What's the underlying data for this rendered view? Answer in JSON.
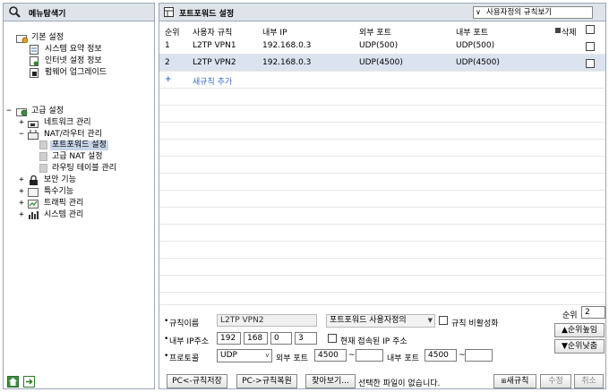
{
  "nav": {
    "title": "메뉴탐색기",
    "basic": {
      "label": "기본 설정",
      "items": [
        "시스템 요약 정보",
        "인터넷 설정 정보",
        "펌웨어 업그레이드"
      ]
    },
    "advanced": {
      "label": "고급 설정",
      "network": "네트워크 관리",
      "nat": "NAT/라우터 관리",
      "nat_items": [
        "포트포워드 설정",
        "고급 NAT 설정",
        "라우팅 테이블 관리"
      ],
      "others": [
        "보안 기능",
        "특수기능",
        "트래픽 관리",
        "시스템 관리"
      ]
    }
  },
  "main": {
    "title": "포트포워드 설정",
    "view_select": "사용자정의 규칙보기"
  },
  "table": {
    "headers": {
      "order": "순위",
      "rule": "사용자 규칙",
      "internal_ip": "내부 IP",
      "external_port": "외부 포트",
      "internal_port": "내부 포트",
      "delete": "삭제"
    },
    "rows": [
      {
        "order": "1",
        "rule": "L2TP VPN1",
        "ip": "192.168.0.3",
        "ext": "UDP(500)",
        "int": "UDP(500)"
      },
      {
        "order": "2",
        "rule": "L2TP VPN2",
        "ip": "192.168.0.3",
        "ext": "UDP(4500)",
        "int": "UDP(4500)"
      }
    ],
    "add_rule": "새규칙 추가",
    "add_plus": "+"
  },
  "form": {
    "rule_name_label": "규칙이름",
    "rule_name": "L2TP VPN2",
    "rule_type": "포트포워드 사용자정의",
    "disable_label": "규칙 비활성화",
    "ip_label": "내부 IP주소",
    "ip": [
      "192",
      "168",
      "0",
      "3"
    ],
    "current_ip_label": "현재 접속된 IP 주소",
    "protocol_label": "프로토콜",
    "protocol": "UDP",
    "ext_port_label": "외부 포트",
    "ext_port_from": "4500",
    "ext_port_to": "",
    "int_port_label": "내부 포트",
    "int_port_from": "4500",
    "int_port_to": "",
    "tilde": "~",
    "bullet": "•",
    "order_label": "순위",
    "order_value": "2",
    "order_up": "순위높임",
    "order_down": "순위낮춤"
  },
  "bottom": {
    "save_to_pc": "PC<-규칙저장",
    "restore_from_pc": "PC->규칙복원",
    "browse": "찾아보기...",
    "file_status": "선택한 파일이 없습니다.",
    "new_rule": "새규칙",
    "modify": "수정",
    "cancel": "취소"
  }
}
